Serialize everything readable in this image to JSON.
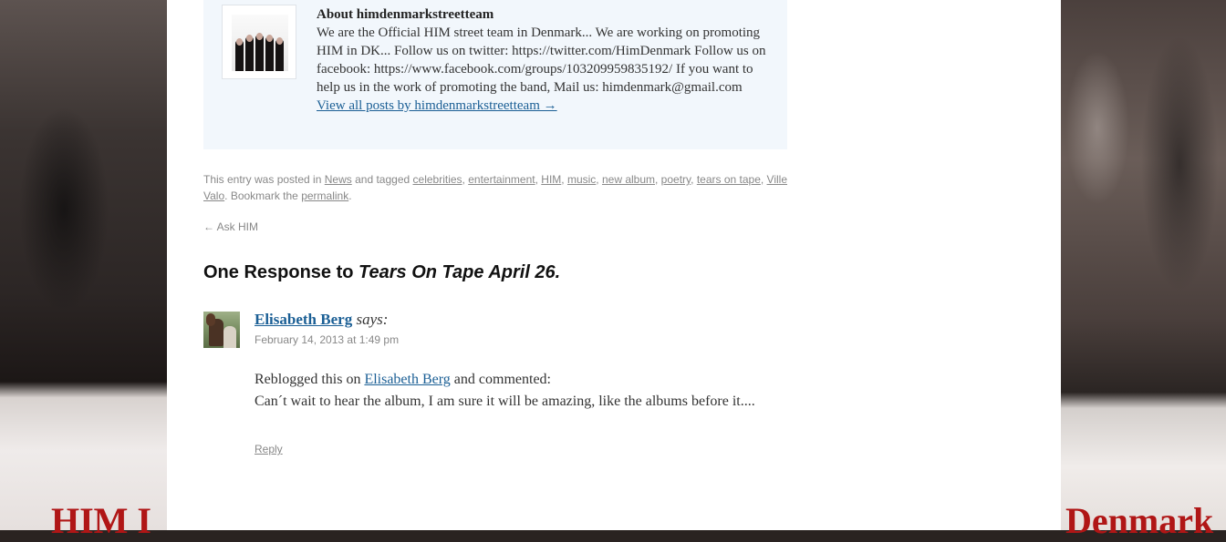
{
  "background": {
    "left_text": "HIM I",
    "right_text": "Denmark"
  },
  "author_box": {
    "title": "About himdenmarkstreetteam",
    "bio": "We are the Official HIM street team in Denmark... We are working on promoting HIM in DK... Follow us on twitter: https://twitter.com/HimDenmark Follow us on facebook: https://www.facebook.com/groups/103209959835192/ If you want to help us in the work of promoting the band, Mail us: himdenmark@gmail.com",
    "view_all_link": "View all posts by himdenmarkstreetteam →"
  },
  "entry_meta": {
    "prefix": "This entry was posted in",
    "category": "News",
    "tagged_text": "and tagged",
    "tags": [
      "celebrities",
      "entertainment",
      "HIM",
      "music",
      "new album",
      "poetry",
      "tears on tape",
      "Ville Valo"
    ],
    "bookmark_text": "Bookmark the",
    "permalink": "permalink"
  },
  "nav": {
    "previous": "← Ask HIM"
  },
  "comments": {
    "title_prefix": "One Response to",
    "title_post": "Tears On Tape April 26.",
    "items": [
      {
        "author": "Elisabeth Berg",
        "says": "says:",
        "date": "February 14, 2013 at 1:49 pm",
        "reblog_prefix": "Reblogged this on",
        "reblog_link": "Elisabeth Berg",
        "reblog_suffix": "and commented:",
        "text": "Can´t wait to hear the album, I am sure it will be amazing, like the albums before it....",
        "reply": "Reply"
      }
    ]
  },
  "colors": {
    "link": "#1b5f95",
    "meta_text": "#888888",
    "author_box_bg": "#f2f7fc"
  }
}
